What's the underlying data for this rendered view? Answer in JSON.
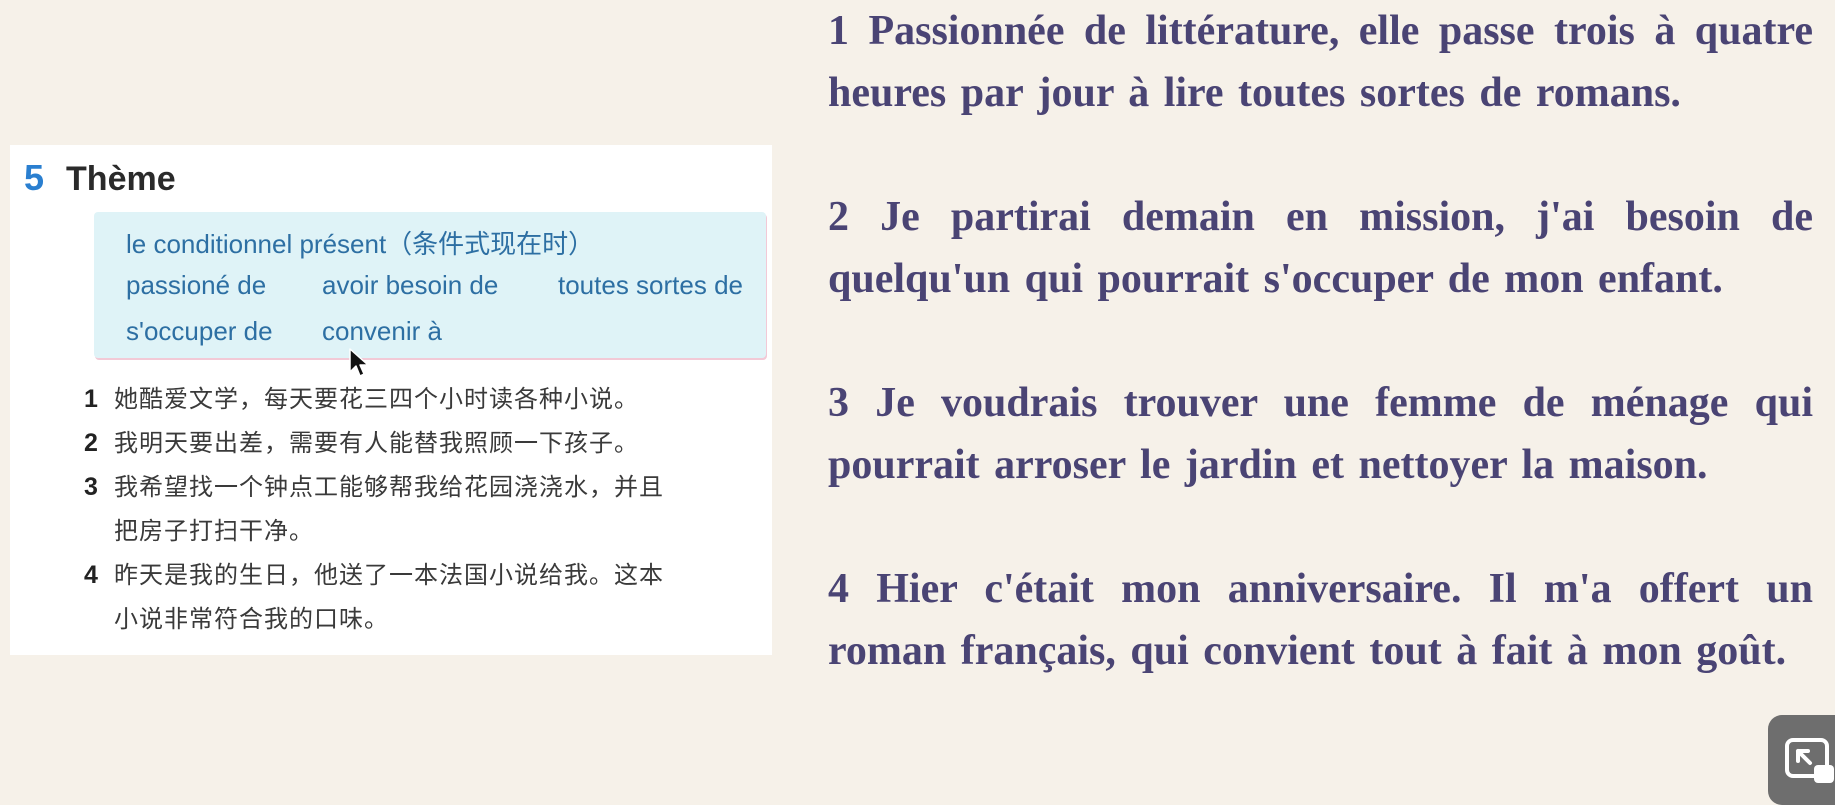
{
  "textbook": {
    "theme_number": "5",
    "theme_title": "Thème",
    "vocab": {
      "heading": "le conditionnel présent（条件式现在时）",
      "items": [
        "passioné de",
        "avoir besoin de",
        "toutes sortes de",
        "s'occuper de",
        "convenir à"
      ]
    },
    "exercises": [
      {
        "num": "1",
        "lines": [
          "她酷爱文学，每天要花三四个小时读各种小说。"
        ]
      },
      {
        "num": "2",
        "lines": [
          "我明天要出差，需要有人能替我照顾一下孩子。"
        ]
      },
      {
        "num": "3",
        "lines": [
          "我希望找一个钟点工能够帮我给花园浇浇水，并且",
          "把房子打扫干净。"
        ]
      },
      {
        "num": "4",
        "lines": [
          "昨天是我的生日，他送了一本法国小说给我。这本",
          "小说非常符合我的口味。"
        ]
      }
    ]
  },
  "answers": [
    "1 Passionnée de littérature, elle passe trois à quatre heures par jour à lire toutes sortes de romans.",
    "2 Je partirai demain en mission, j'ai besoin de quelqu'un qui pourrait s'occuper de mon enfant.",
    "3 Je voudrais trouver une femme de ménage qui pourrait arroser le jardin et nettoyer la maison.",
    "4 Hier c'était mon anniversaire. Il m'a offert un roman français, qui convient tout à fait à mon goût."
  ],
  "colors": {
    "background": "#f6f1e9",
    "answer_text": "#4a4474",
    "theme_number": "#2a7fd0",
    "vocab_text": "#2d6fa3",
    "vocab_box": "#dff3f7"
  },
  "icons": {
    "cursor": "mouse-pointer-icon",
    "pip": "picture-in-picture-icon"
  }
}
